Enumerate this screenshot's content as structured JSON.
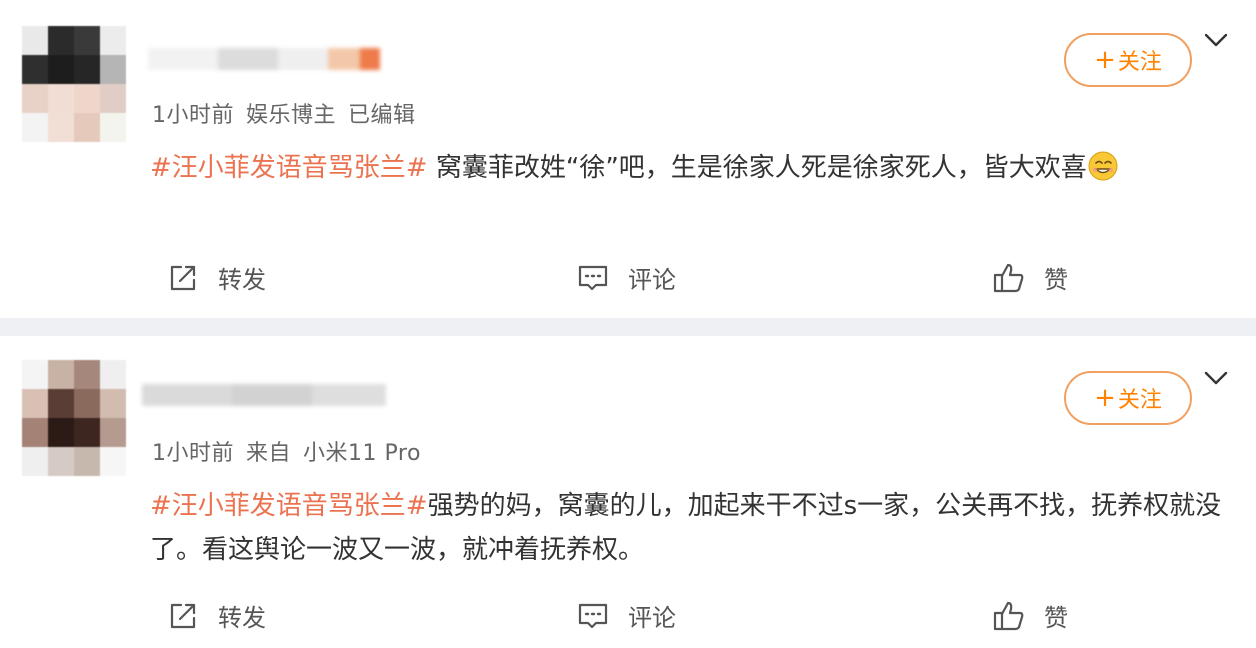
{
  "posts": [
    {
      "meta": {
        "time": "1小时前",
        "source": "娱乐博主",
        "status": "已编辑"
      },
      "follow_label": "关注",
      "follow_plus": "+",
      "content": {
        "hashtag": "#汪小菲发语音骂张兰#",
        "text": " 窝囊菲改姓“徐”吧，生是徐家人死是徐家死人，皆大欢喜"
      },
      "actions": {
        "repost": "转发",
        "comment": "评论",
        "like": "赞"
      }
    },
    {
      "meta": {
        "time": "1小时前",
        "source": "来自",
        "status": "小米11 Pro"
      },
      "follow_label": "关注",
      "follow_plus": "+",
      "content": {
        "hashtag": "#汪小菲发语音骂张兰#",
        "text": "强势的妈，窝囊的儿，加起来干不过s一家，公关再不找，抚养权就没了。看这舆论一波又一波，就冲着抚养权。"
      },
      "actions": {
        "repost": "转发",
        "comment": "评论",
        "like": "赞"
      }
    }
  ],
  "colors": {
    "hashtag": "#eb7350",
    "follow_border": "#f0a060",
    "follow_text": "#ff8200",
    "divider": "#eef0f3",
    "meta_text": "#666666"
  },
  "icons": [
    "repost-icon",
    "comment-icon",
    "like-icon",
    "chevron-down-icon",
    "grin-emoji"
  ]
}
